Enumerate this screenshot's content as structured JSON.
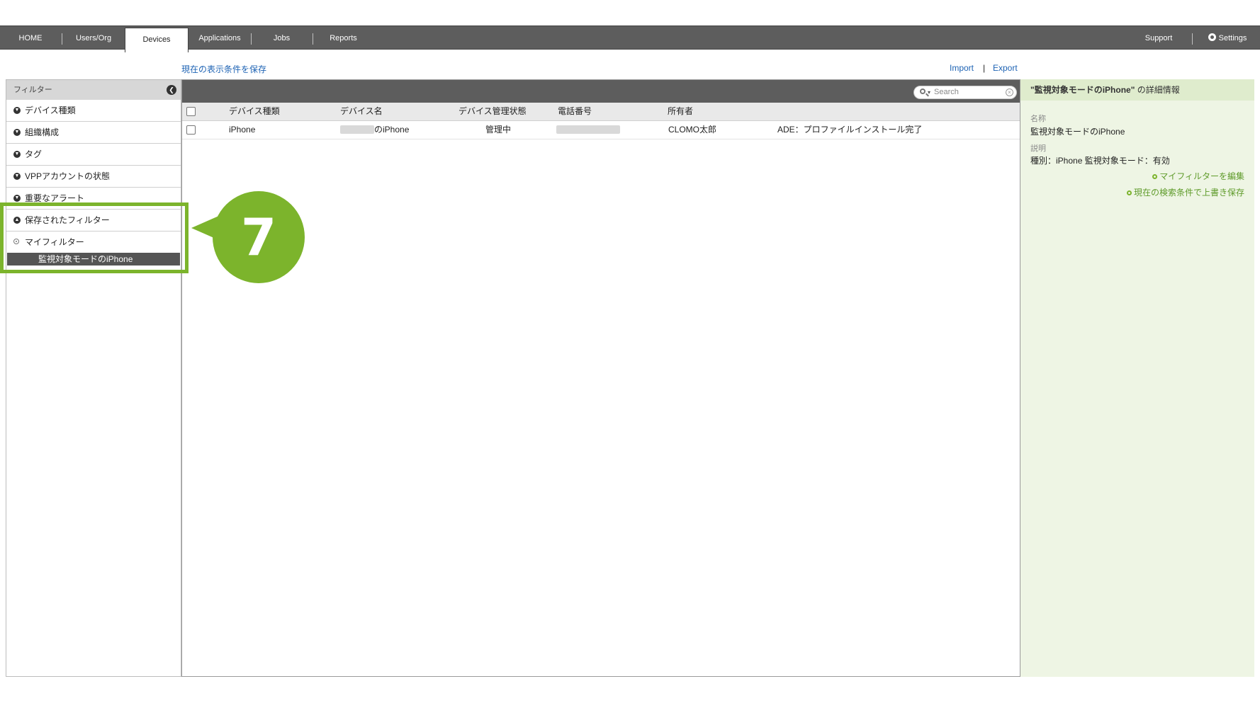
{
  "nav": {
    "tabs": [
      {
        "label": "HOME"
      },
      {
        "label": "Users/Org"
      },
      {
        "label": "Devices",
        "active": true
      },
      {
        "label": "Applications"
      },
      {
        "label": "Jobs"
      },
      {
        "label": "Reports"
      }
    ],
    "support": "Support",
    "settings": "Settings"
  },
  "actions": {
    "save_view": "現在の表示条件を保存",
    "import": "Import",
    "separator": "|",
    "export": "Export"
  },
  "sidebar": {
    "header": "フィルター",
    "collapse_icon": "chevron-left-icon",
    "items": [
      {
        "label": "デバイス種類"
      },
      {
        "label": "組織構成"
      },
      {
        "label": "タグ"
      },
      {
        "label": "VPPアカウントの状態"
      },
      {
        "label": "重要なアラート"
      },
      {
        "label": "保存されたフィルター"
      }
    ],
    "my_filter": "マイフィルター",
    "selected_filter": "監視対象モードのiPhone"
  },
  "callout": {
    "number": "7",
    "color": "#7cb42c"
  },
  "search": {
    "placeholder": "Search"
  },
  "table": {
    "columns": [
      "デバイス種類",
      "デバイス名",
      "デバイス管理状態",
      "電話番号",
      "所有者",
      ""
    ],
    "rows": [
      {
        "type": "iPhone",
        "name_suffix": "のiPhone",
        "status": "管理中",
        "phone": "",
        "owner": "CLOMO太郎",
        "note": "ADE：プロファイルインストール完了"
      }
    ]
  },
  "detail": {
    "title": "\"監視対象モードのiPhone\"",
    "title_suffix": " の詳細情報",
    "name_label": "名称",
    "name_value": "監視対象モードのiPhone",
    "desc_label": "説明",
    "desc_value": "種別：iPhone 監視対象モード：有効",
    "edit_link": "マイフィルターを編集",
    "overwrite_link": "現在の検索条件で上書き保存"
  }
}
